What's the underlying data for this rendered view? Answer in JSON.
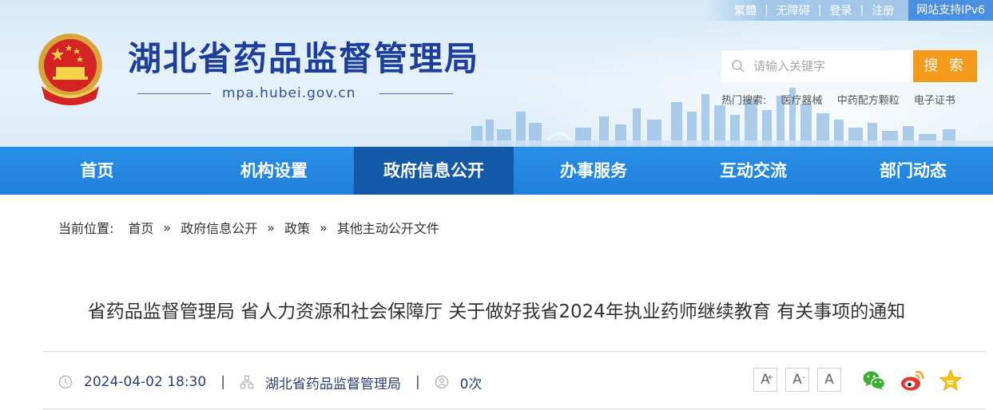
{
  "header": {
    "site_title": "湖北省药品监督管理局",
    "domain": "mpa.hubei.gov.cn",
    "toplinks": [
      "繁體",
      "无障碍",
      "登录",
      "注册"
    ],
    "ipv6_badge": "网站支持IPv6",
    "search": {
      "placeholder": "请输入关键字",
      "button": "搜 索"
    },
    "hot_search": {
      "label": "热门搜索:",
      "items": [
        "医疗器械",
        "中药配方颗粒",
        "电子证书"
      ]
    }
  },
  "nav": {
    "items": [
      "首页",
      "机构设置",
      "政府信息公开",
      "办事服务",
      "互动交流",
      "部门动态"
    ],
    "active_index": 2
  },
  "breadcrumb": {
    "label": "当前位置:",
    "items": [
      "首页",
      "政府信息公开",
      "政策",
      "其他主动公开文件"
    ],
    "separator": "»"
  },
  "article": {
    "title": "省药品监督管理局 省人力资源和社会保障厅 关于做好我省2024年执业药师继续教育 有关事项的通知",
    "datetime": "2024-04-02 18:30",
    "source": "湖北省药品监督管理局",
    "views": "0次"
  },
  "font_controls": [
    "A",
    "A",
    "A"
  ],
  "colors": {
    "nav_bg": "#1e7fdc",
    "nav_active": "#1459a8",
    "search_button": "#f59b1b",
    "title_blue": "#1d3f9b"
  },
  "icons": [
    "clock-icon",
    "sitemap-icon",
    "user-icon",
    "wechat-icon",
    "weibo-icon",
    "star-icon"
  ]
}
